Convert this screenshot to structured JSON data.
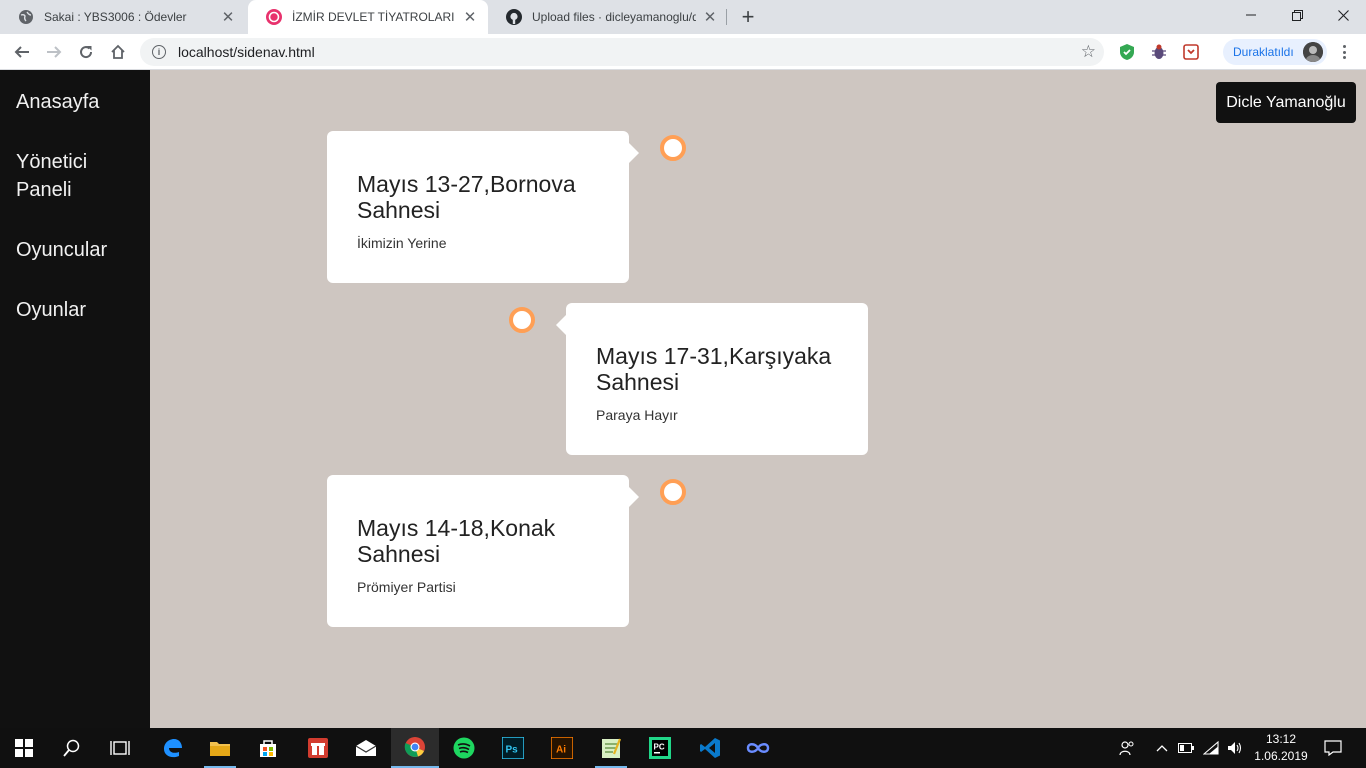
{
  "browser": {
    "tabs": [
      {
        "title": "Sakai : YBS3006 : Ödevler",
        "icon": "globe-icon",
        "active": false
      },
      {
        "title": "İZMİR DEVLET TİYATROLARI",
        "icon": "site-logo-icon",
        "active": true
      },
      {
        "title": "Upload files · dicleyamanoglu/dc",
        "icon": "github-icon",
        "active": false
      }
    ],
    "url": "localhost/sidenav.html",
    "profile_label": "Duraklatıldı"
  },
  "page": {
    "nav": [
      "Anasayfa",
      "Yönetici Paneli",
      "Oyuncular",
      "Oyunlar"
    ],
    "user_button": "Dicle Yamanoğlu",
    "timeline": [
      {
        "title": "Mayıs 13-27,Bornova Sahnesi",
        "subtitle": "İkimizin Yerine"
      },
      {
        "title": "Mayıs 17-31,Karşıyaka Sahnesi",
        "subtitle": "Paraya Hayır"
      },
      {
        "title": "Mayıs 14-18,Konak Sahnesi",
        "subtitle": "Prömiyer Partisi"
      }
    ],
    "accent_color": "#ff9f55",
    "background_color": "#cec6c1",
    "sidebar_color": "#111111"
  },
  "taskbar": {
    "apps": [
      "start-icon",
      "search-icon",
      "task-view-icon",
      "edge-icon",
      "file-explorer-icon",
      "store-icon",
      "gift-icon",
      "mail-icon",
      "chrome-icon",
      "spotify-icon",
      "photoshop-icon",
      "illustrator-icon",
      "notepad-icon",
      "pycharm-icon",
      "vscode-icon",
      "app-icon"
    ],
    "time": "13:12",
    "date": "1.06.2019"
  }
}
